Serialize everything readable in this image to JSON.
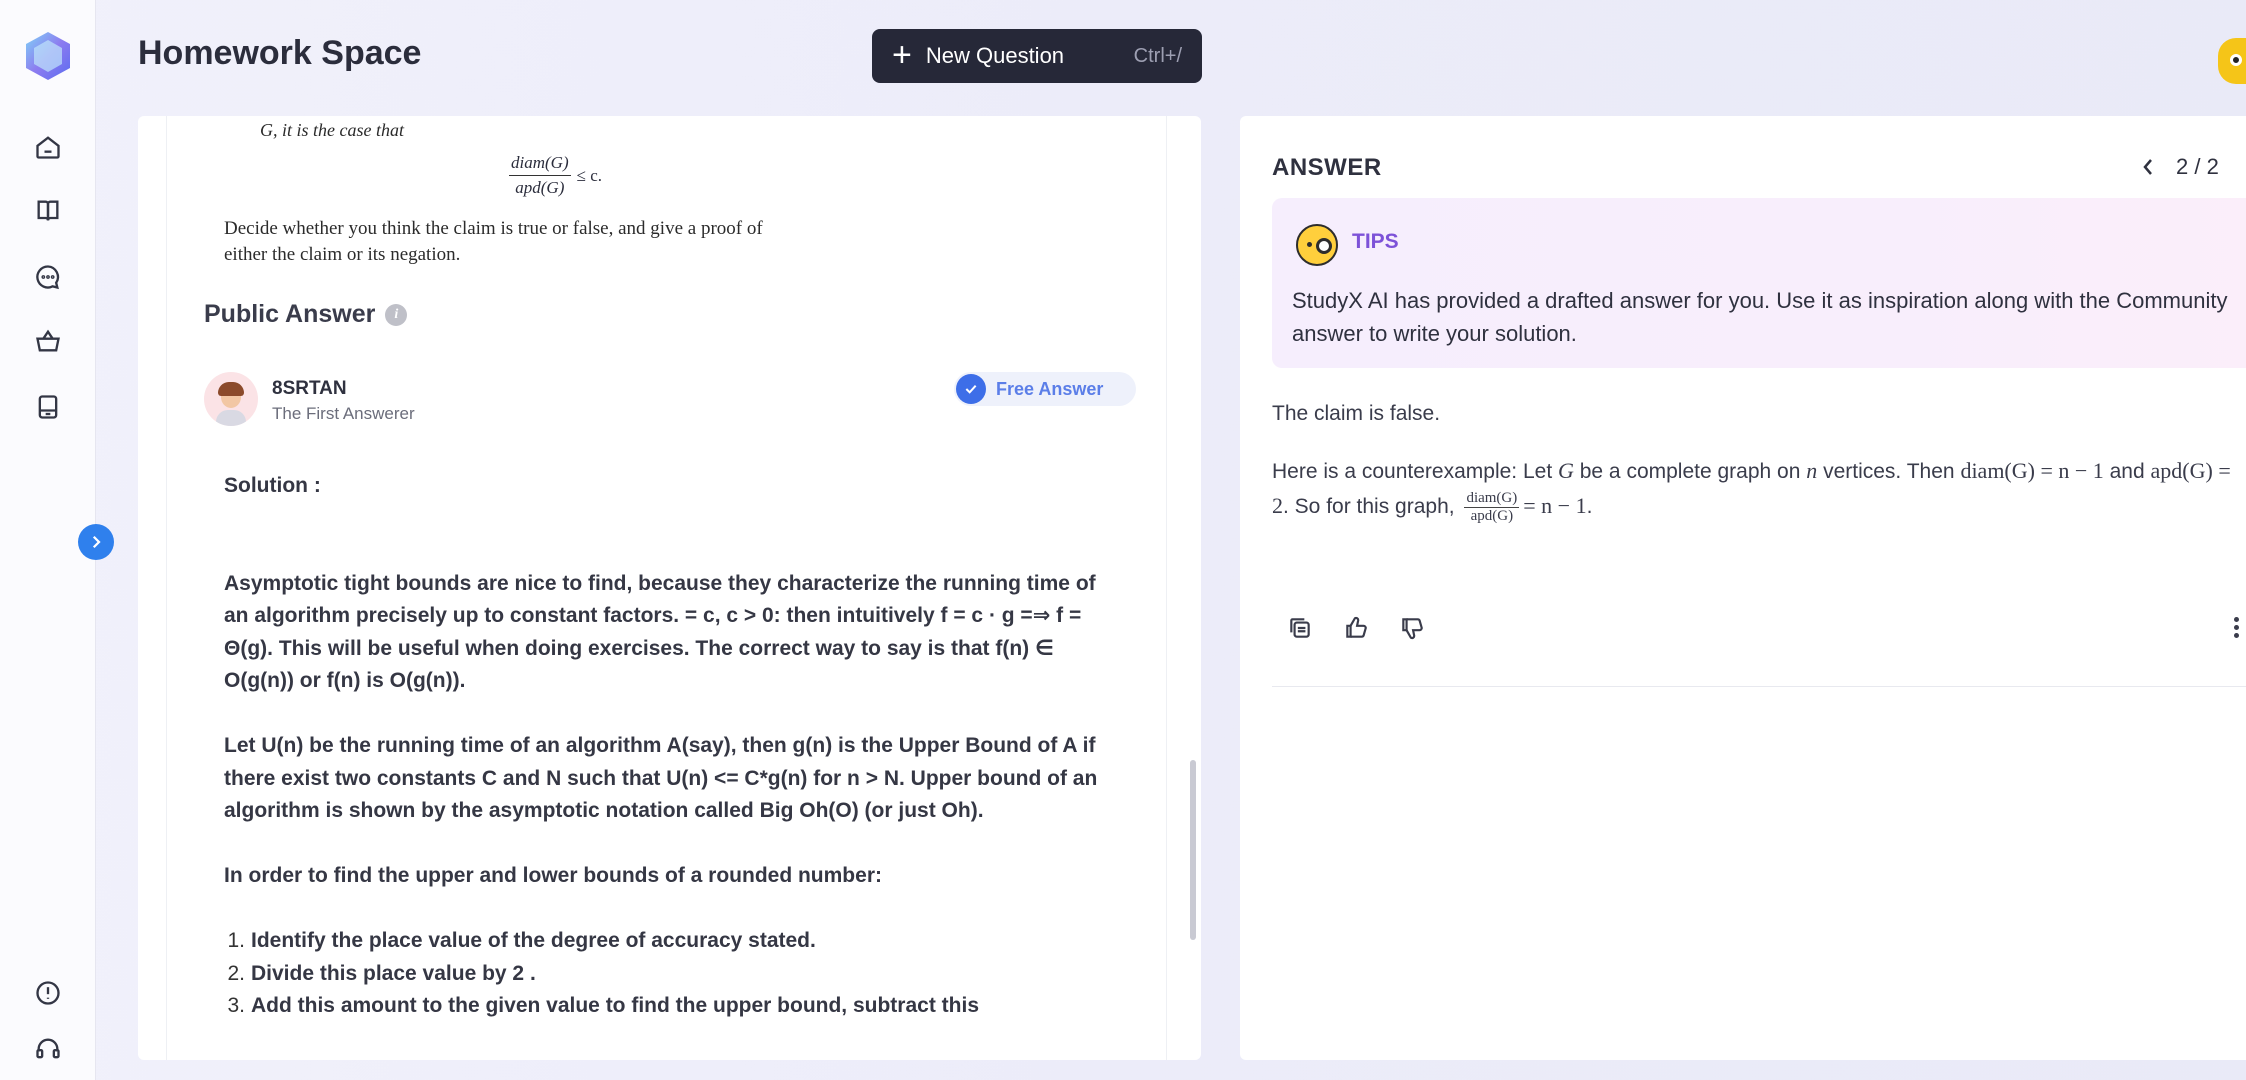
{
  "app": {
    "title": "Homework Space"
  },
  "header": {
    "new_question_label": "New Question",
    "new_question_shortcut": "Ctrl+/"
  },
  "sidebar": {
    "items": [
      {
        "name": "home",
        "icon": "home-icon"
      },
      {
        "name": "book",
        "icon": "book-open-icon"
      },
      {
        "name": "chat",
        "icon": "chat-bubble-icon"
      },
      {
        "name": "basket",
        "icon": "basket-icon"
      },
      {
        "name": "document",
        "icon": "document-icon"
      }
    ],
    "bottom_items": [
      {
        "name": "feedback",
        "icon": "alert-circle-icon"
      },
      {
        "name": "support",
        "icon": "headset-icon"
      }
    ]
  },
  "question": {
    "line1": "G, it is the case that",
    "fraction_num": "diam(G)",
    "fraction_den": "apd(G)",
    "fraction_rel": "≤ c.",
    "line2": "Decide whether you think the claim is true or false, and give a proof of",
    "line3": "either the claim or its negation."
  },
  "public_answer": {
    "title": "Public Answer",
    "info": "i",
    "user_name": "8SRTAN",
    "user_role": "The First Answerer",
    "badge": "Free Answer",
    "solution_heading": "Solution :",
    "para1": "Asymptotic tight bounds are nice to find, because they characterize the running time of an algorithm precisely up to constant factors. = c, c > 0: then intuitively f = c · g =⇒ f = Θ(g). This will be useful when doing exercises. The correct way to say is that f(n) ∈ O(g(n)) or f(n) is O(g(n)).",
    "para2": "Let U(n) be the running time of an algorithm A(say), then g(n) is the Upper Bound of A if there exist two constants C and N such that U(n) <= C*g(n) for n > N. Upper bound of an algorithm is shown by the asymptotic notation called Big Oh(O) (or just Oh).",
    "para3": "In order to find the upper and lower bounds of a rounded number:",
    "steps": [
      {
        "n": "1.",
        "text": "Identify the place value of the degree of accuracy stated."
      },
      {
        "n": "2.",
        "text": "Divide this place value by 2 ."
      },
      {
        "n": "3.",
        "text": "Add this amount to the given value to find the upper bound, subtract this"
      }
    ]
  },
  "answer": {
    "title": "ANSWER",
    "pager": "2 / 2",
    "tips_label": "TIPS",
    "tips_text": "StudyX AI has provided a drafted answer for you. Use it as inspiration along with the Community answer to write your solution.",
    "claim": "The claim is false.",
    "counter_prefix": "Here is a counterexample: Let",
    "counter_G": "G",
    "counter_mid1": "be a complete graph on",
    "counter_n": "n",
    "counter_mid2": "vertices. Then",
    "counter_diam": "diam(G) = n − 1",
    "counter_and": "and",
    "counter_apd": "apd(G) = 2",
    "counter_mid3": ". So for this graph,",
    "counter_frac_num": "diam(G)",
    "counter_frac_den": "apd(G)",
    "counter_result": "= n − 1",
    "counter_end": "."
  },
  "colors": {
    "accent": "#2f80ed",
    "header_button": "#262838",
    "tips_label": "#7d52d8",
    "badge_text": "#5b7ee8"
  }
}
